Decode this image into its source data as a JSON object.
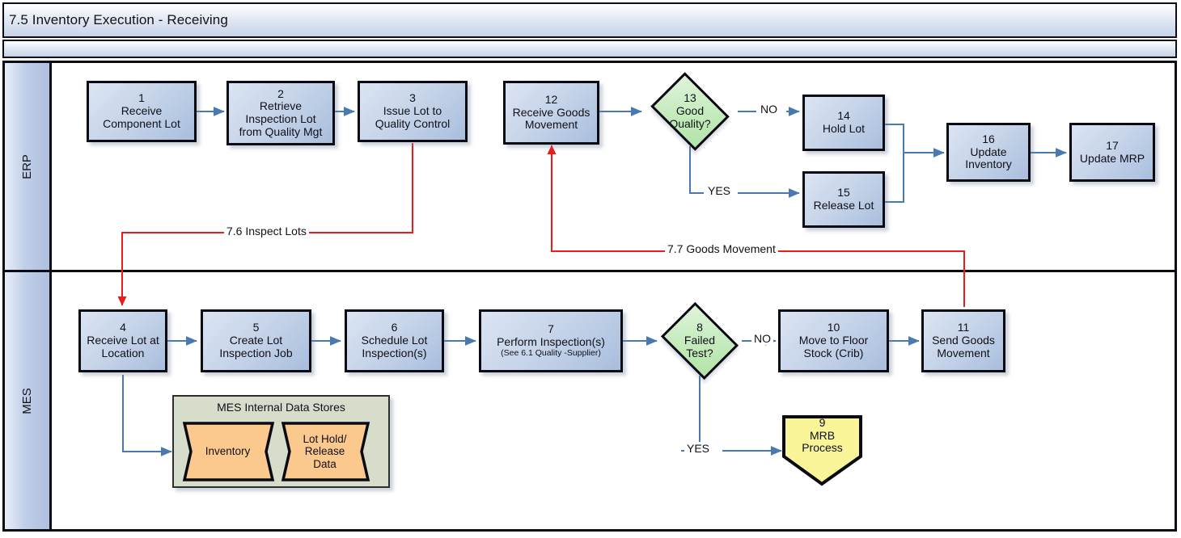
{
  "header": {
    "title": "7.5 Inventory Execution - Receiving"
  },
  "lanes": [
    {
      "id": "erp",
      "label": "ERP"
    },
    {
      "id": "mes",
      "label": "MES"
    }
  ],
  "nodes": {
    "n1": {
      "num": "1",
      "label": "Receive\nComponent Lot"
    },
    "n2": {
      "num": "2",
      "label": "Retrieve\nInspection Lot\nfrom Quality Mgt"
    },
    "n3": {
      "num": "3",
      "label": "Issue Lot to\nQuality Control"
    },
    "n12": {
      "num": "12",
      "label": "Receive Goods\nMovement"
    },
    "n13": {
      "num": "13",
      "label": "Good\nQuality?"
    },
    "n14": {
      "num": "14",
      "label": "Hold Lot"
    },
    "n15": {
      "num": "15",
      "label": "Release Lot"
    },
    "n16": {
      "num": "16",
      "label": "Update\nInventory"
    },
    "n17": {
      "num": "17",
      "label": "Update MRP"
    },
    "n4": {
      "num": "4",
      "label": "Receive Lot at\nLocation"
    },
    "n5": {
      "num": "5",
      "label": "Create Lot\nInspection Job"
    },
    "n6": {
      "num": "6",
      "label": "Schedule Lot\nInspection(s)"
    },
    "n7": {
      "num": "7",
      "label": "Perform Inspection(s)",
      "sub": "(See 6.1 Quality -Supplier)"
    },
    "n8": {
      "num": "8",
      "label": "Failed\nTest?"
    },
    "n9": {
      "num": "9",
      "label": "MRB\nProcess"
    },
    "n10": {
      "num": "10",
      "label": "Move to Floor\nStock (Crib)"
    },
    "n11": {
      "num": "11",
      "label": "Send Goods\nMovement"
    }
  },
  "datastores": {
    "group_title": "MES Internal Data Stores",
    "items": [
      {
        "label": "Inventory"
      },
      {
        "label": "Lot Hold/\nRelease\nData"
      }
    ]
  },
  "edge_labels": {
    "no_13": "NO",
    "yes_13": "YES",
    "no_8": "NO",
    "yes_8": "YES",
    "inspect_lots": "7.6 Inspect Lots",
    "goods_movement": "7.7 Goods Movement"
  },
  "colors": {
    "process_fill": "#c6d4e9",
    "decision_fill": "#c4ebbc",
    "mrb_fill": "#fbf59a",
    "datastore_fill": "#fbc98e",
    "datastore_group_fill": "#d6ddcb",
    "connector_blue": "#4a78b0",
    "connector_red": "#ee1b1b",
    "lane_header_fill": "#c0cfe8",
    "border_dark": "#0a0a12"
  }
}
